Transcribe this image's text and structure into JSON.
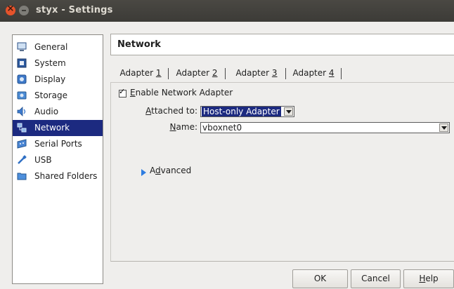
{
  "window": {
    "title": "styx - Settings"
  },
  "sidebar": {
    "items": [
      {
        "label": "General",
        "icon": "monitor-icon"
      },
      {
        "label": "System",
        "icon": "chip-icon"
      },
      {
        "label": "Display",
        "icon": "display-icon"
      },
      {
        "label": "Storage",
        "icon": "disk-icon"
      },
      {
        "label": "Audio",
        "icon": "speaker-icon"
      },
      {
        "label": "Network",
        "icon": "network-icon",
        "selected": true
      },
      {
        "label": "Serial Ports",
        "icon": "serial-port-icon"
      },
      {
        "label": "USB",
        "icon": "usb-icon"
      },
      {
        "label": "Shared Folders",
        "icon": "folder-icon"
      }
    ]
  },
  "header": {
    "title": "Network"
  },
  "tabs": [
    {
      "prefix": "Adapter ",
      "mnemonic": "1"
    },
    {
      "prefix": "Adapter ",
      "mnemonic": "2"
    },
    {
      "prefix": "Adapter ",
      "mnemonic": "3",
      "active": true
    },
    {
      "prefix": "Adapter ",
      "mnemonic": "4"
    }
  ],
  "adapter": {
    "enable_mnemonic": "E",
    "enable_rest": "nable Network Adapter",
    "enabled": true,
    "attached_mnemonic": "A",
    "attached_rest": "ttached to:",
    "attached_value": "Host-only Adapter",
    "name_mnemonic": "N",
    "name_rest": "ame:",
    "name_value": "vboxnet0",
    "advanced_pre": "A",
    "advanced_mnemonic": "d",
    "advanced_rest": "vanced"
  },
  "buttons": {
    "ok": "OK",
    "cancel": "Cancel",
    "help_mnemonic": "H",
    "help_rest": "elp"
  },
  "colors": {
    "selection": "#1c2a80",
    "titlebar": "#3c3b37",
    "close": "#e6532b"
  }
}
